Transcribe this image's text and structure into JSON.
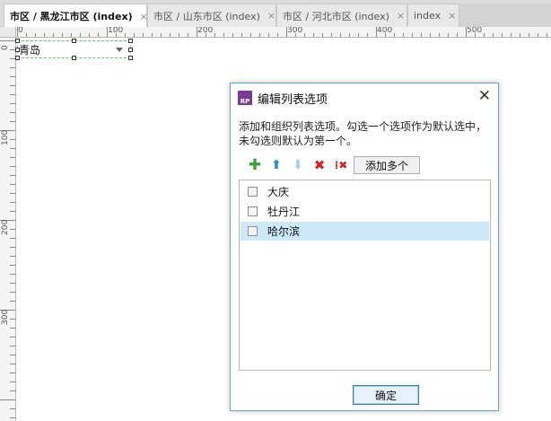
{
  "tabs": [
    {
      "label": "市区 / 黑龙江市区 (index)",
      "close": "×"
    },
    {
      "label": "市区 / 山东市区 (index)",
      "close": "×"
    },
    {
      "label": "市区 / 河北市区 (index)",
      "close": "×"
    },
    {
      "label": "index",
      "close": "×"
    }
  ],
  "ruler": {
    "top_labels": [
      "0",
      "100",
      "200",
      "300",
      "400",
      "500"
    ],
    "left_labels": [
      "0",
      "100",
      "200",
      "300"
    ]
  },
  "canvas": {
    "droplist_value": "青岛"
  },
  "dialog": {
    "icon_text": "RP",
    "title": "编辑列表选项",
    "close": "✕",
    "description": "添加和组织列表选项。勾选一个选项作为默认选中，未勾选则默认为第一个。",
    "toolbar": {
      "add_icon": "plus-icon",
      "up_icon": "arrow-up-icon",
      "down_icon": "arrow-down-icon",
      "delete_icon": "delete-icon",
      "delete_all_icon": "delete-all-icon",
      "add_multiple_label": "添加多个"
    },
    "items": [
      {
        "label": "大庆",
        "checked": false,
        "selected": false
      },
      {
        "label": "牡丹江",
        "checked": false,
        "selected": false
      },
      {
        "label": "哈尔滨",
        "checked": false,
        "selected": true
      }
    ],
    "ok_label": "确定"
  },
  "colors": {
    "selection_highlight": "#cde8f6",
    "dialog_border": "#6da4c6",
    "ok_button_border": "#3c7fb1"
  }
}
